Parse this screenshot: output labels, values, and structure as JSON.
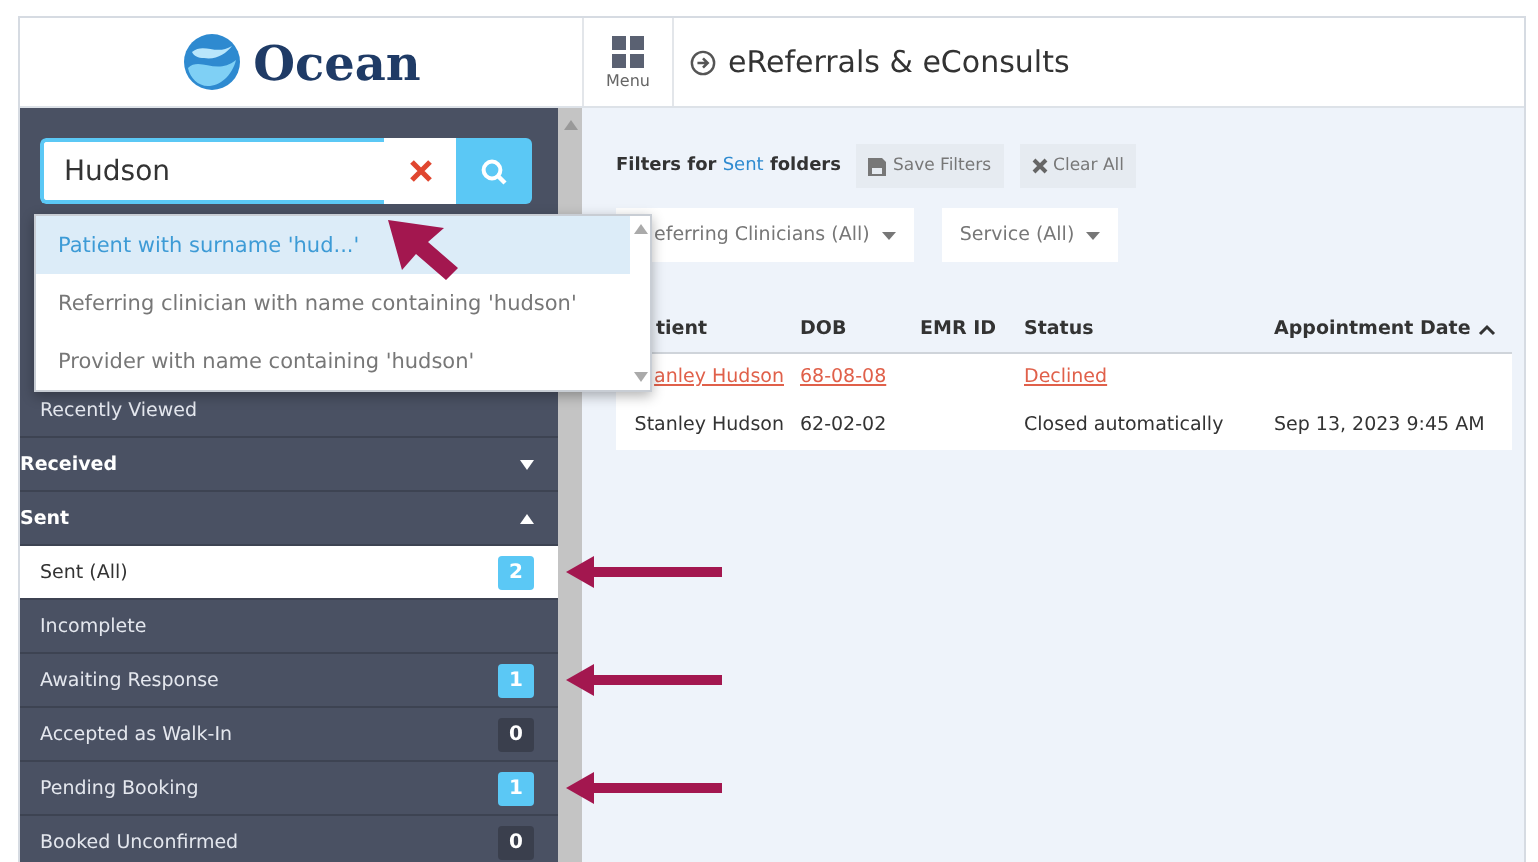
{
  "header": {
    "brand": "Ocean",
    "menu_label": "Menu",
    "title": "eReferrals & eConsults"
  },
  "search": {
    "value": "Hudson"
  },
  "suggestions": [
    {
      "label": "Patient with surname 'hud...'",
      "selected": true
    },
    {
      "label": "Referring clinician with name containing 'hudson'",
      "selected": false
    },
    {
      "label": "Provider with name containing 'hudson'",
      "selected": false
    }
  ],
  "sidebar": {
    "items": [
      {
        "kind": "item",
        "label": "Recently Viewed",
        "selected": false
      },
      {
        "kind": "section",
        "label": "Received",
        "expanded": false
      },
      {
        "kind": "section",
        "label": "Sent",
        "expanded": true
      },
      {
        "kind": "item",
        "label": "Sent (All)",
        "count": "2",
        "highlight": true,
        "selected": true,
        "pointed": true
      },
      {
        "kind": "item",
        "label": "Incomplete",
        "selected": false
      },
      {
        "kind": "item",
        "label": "Awaiting Response",
        "count": "1",
        "highlight": true,
        "selected": false,
        "pointed": true
      },
      {
        "kind": "item",
        "label": "Accepted as Walk-In",
        "count": "0",
        "highlight": false,
        "selected": false
      },
      {
        "kind": "item",
        "label": "Pending Booking",
        "count": "1",
        "highlight": true,
        "selected": false,
        "pointed": true
      },
      {
        "kind": "item",
        "label": "Booked Unconfirmed",
        "count": "0",
        "highlight": false,
        "selected": false
      }
    ]
  },
  "filters": {
    "prefix": "Filters for ",
    "folder": "Sent",
    "suffix": " folders",
    "save": "Save Filters",
    "clear": "Clear All",
    "dropdowns": [
      "eferring Clinicians (All)",
      "Service (All)"
    ]
  },
  "table": {
    "columns": [
      "tient",
      "DOB",
      "EMR ID",
      "Status",
      "Appointment Date"
    ],
    "rows": [
      {
        "declined": true,
        "cells": [
          "anley Hudson",
          "68-08-08",
          "",
          "Declined",
          ""
        ]
      },
      {
        "declined": false,
        "cells": [
          "Stanley Hudson",
          "62-02-02",
          "",
          "Closed automatically",
          "Sep 13, 2023 9:45 AM"
        ]
      }
    ]
  }
}
